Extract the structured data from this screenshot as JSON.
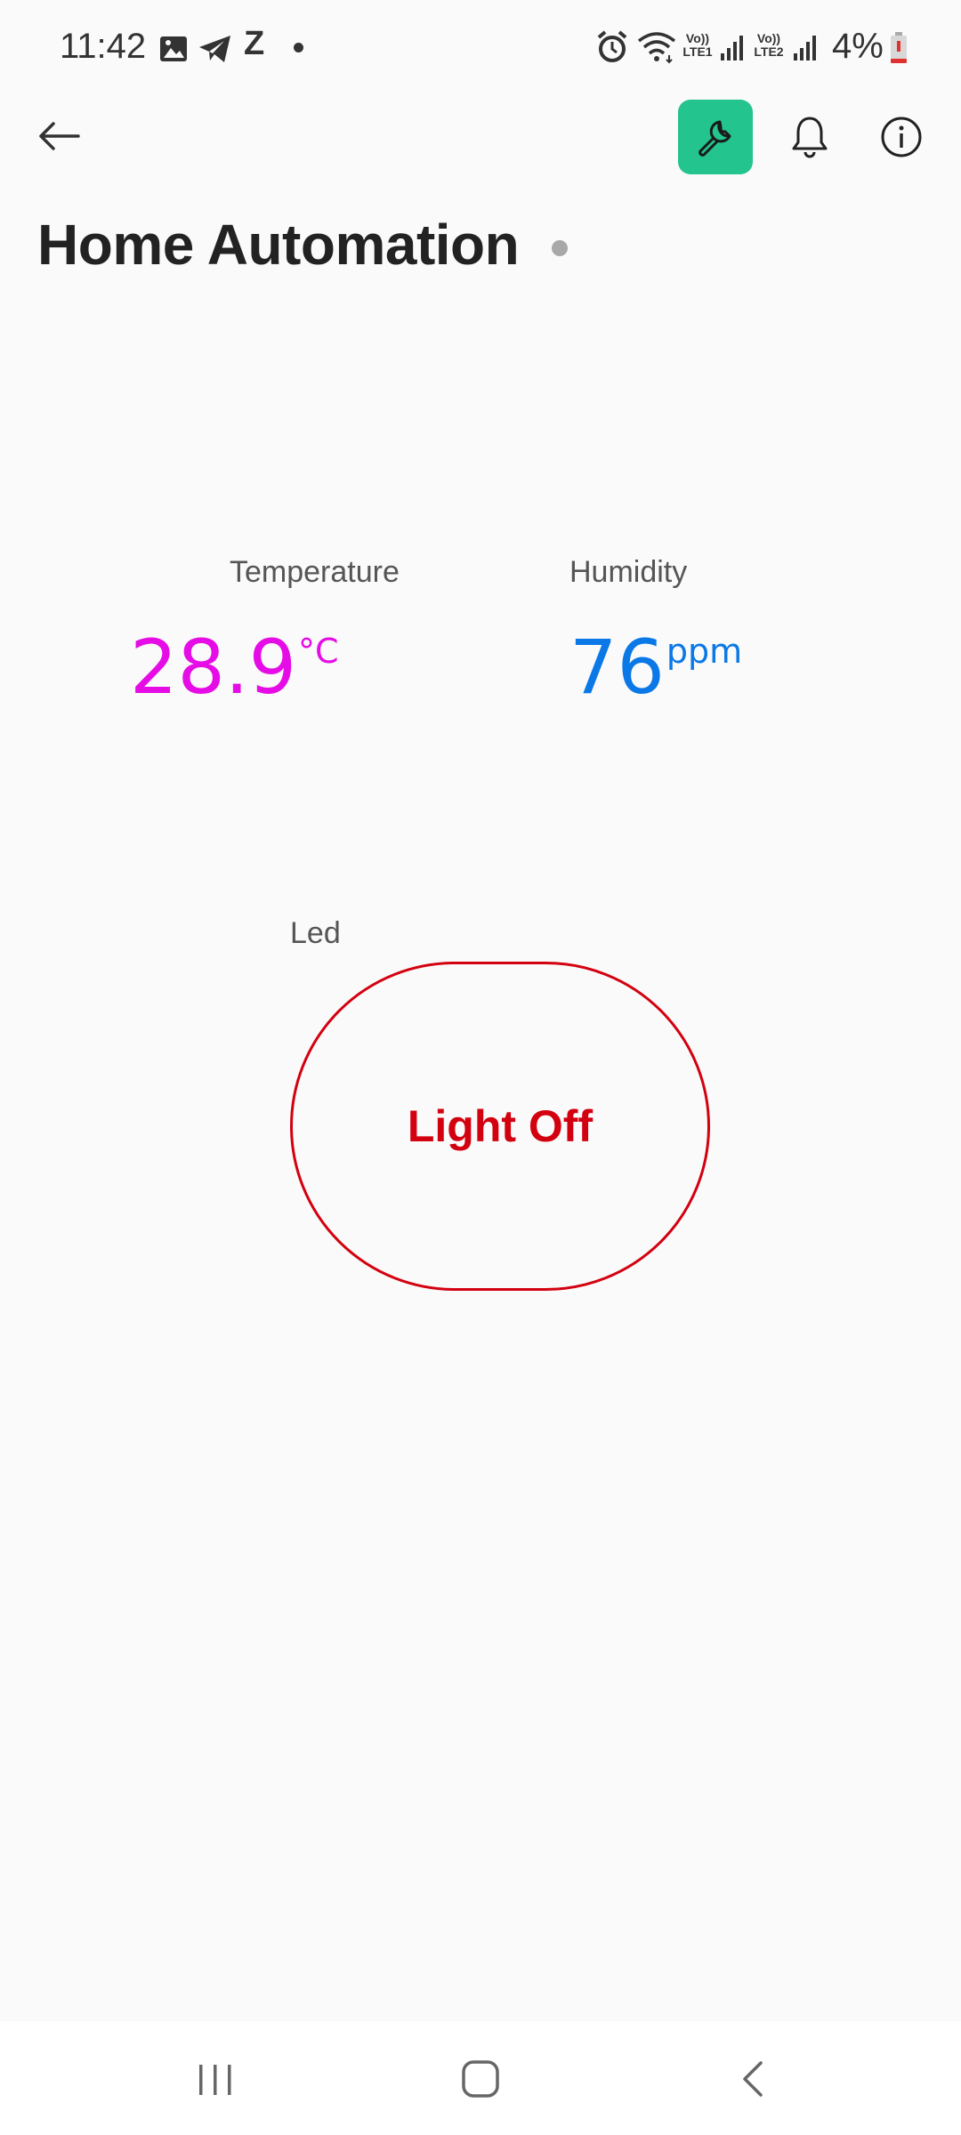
{
  "status_bar": {
    "time": "11:42",
    "notification_icons": [
      "image-icon",
      "telegram-icon",
      "z-icon",
      "dot-icon"
    ],
    "z_glyph": "Z",
    "system_icons": [
      "alarm-icon",
      "wifi-icon",
      "signal-lte1-icon",
      "signal-lte2-icon",
      "battery-low-icon"
    ],
    "lte1_label": "Vo)) LTE1",
    "lte2_label": "Vo)) LTE2",
    "battery_percent": "4%"
  },
  "header": {
    "back_icon": "arrow-left-icon",
    "tool_icon": "wrench-icon",
    "bell_icon": "bell-icon",
    "info_icon": "info-icon",
    "accent_color": "#23c48e"
  },
  "page": {
    "title": "Home Automation",
    "status_dot_color": "#a8a8a8"
  },
  "widgets": {
    "temperature": {
      "label": "Temperature",
      "value": "28.9",
      "unit": "°C",
      "color": "#e60ce6"
    },
    "humidity": {
      "label": "Humidity",
      "value": "76",
      "unit": "ppm",
      "color": "#0a78e6"
    },
    "led": {
      "label": "Led",
      "button_text": "Light Off",
      "color": "#d3000f"
    }
  },
  "nav_bar": {
    "icons": [
      "recents-icon",
      "home-icon",
      "back-icon"
    ]
  }
}
